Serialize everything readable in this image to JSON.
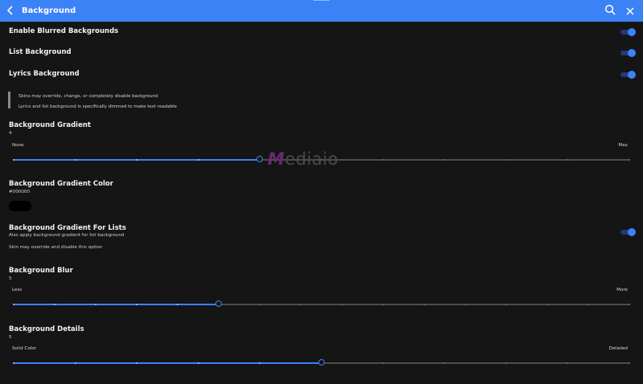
{
  "header": {
    "title": "Background",
    "accent": "#3b82f6",
    "icons": [
      "back-icon",
      "search-icon",
      "close-icon"
    ]
  },
  "settings": {
    "blurred_backgrounds": {
      "label": "Enable Blurred Backgrounds",
      "enabled": true
    },
    "list_background": {
      "label": "List Background",
      "enabled": true
    },
    "lyrics_background": {
      "label": "Lyrics Background",
      "enabled": true
    },
    "note": {
      "line1": "Skins may override, change, or completely disable background",
      "line2": "Lyrics and list background is specifically dimmed to make text readable"
    },
    "gradient": {
      "label": "Background Gradient",
      "value": "4",
      "min_label": "None",
      "max_label": "Max",
      "level": 4,
      "steps": 10
    },
    "gradient_color": {
      "label": "Background Gradient Color",
      "value": "#000000",
      "swatch": "#000000"
    },
    "gradient_for_lists": {
      "label": "Background Gradient For Lists",
      "sub": "Also apply background gradient for list background",
      "hint": "Skin may override and disable this option",
      "enabled": true
    },
    "blur": {
      "label": "Background Blur",
      "value": "5",
      "min_label": "Less",
      "max_label": "More",
      "level": 5,
      "steps": 15
    },
    "details": {
      "label": "Background Details",
      "value": "5",
      "min_label": "Solid Color",
      "max_label": "Detailed",
      "level": 5,
      "steps": 10
    }
  },
  "watermark": {
    "first": "M",
    "rest": "ediaio"
  }
}
